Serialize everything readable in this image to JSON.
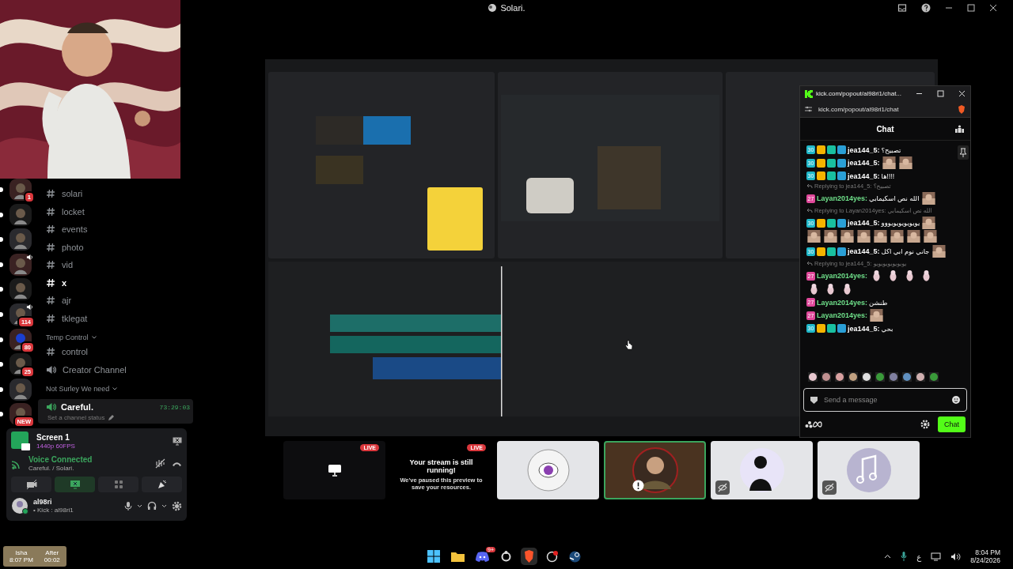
{
  "window": {
    "title": "Solari."
  },
  "webcam": {
    "kind": "picture"
  },
  "servers": [
    {
      "unread": true,
      "badge": "1"
    },
    {
      "unread": true
    },
    {
      "unread": true
    },
    {
      "unread": true,
      "voice": true
    },
    {
      "unread": true
    },
    {
      "unread": true,
      "voice": true,
      "badge": "114"
    },
    {
      "unread": true,
      "badge": "80"
    },
    {
      "unread": true,
      "badge": "25"
    },
    {
      "unread": true
    },
    {
      "unread": true,
      "badge": "NEW"
    }
  ],
  "channels": [
    {
      "kind": "text",
      "name": "solari",
      "unread": false
    },
    {
      "kind": "text",
      "name": "locket",
      "unread": false
    },
    {
      "kind": "text",
      "name": "events",
      "unread": false
    },
    {
      "kind": "text",
      "name": "photo",
      "unread": false
    },
    {
      "kind": "text",
      "name": "vid",
      "unread": false
    },
    {
      "kind": "text",
      "name": "x",
      "unread": true
    },
    {
      "kind": "text",
      "name": "ajr",
      "unread": false
    },
    {
      "kind": "text",
      "name": "tklegat",
      "unread": false
    },
    {
      "kind": "category",
      "name": "Temp Control",
      "children": [
        {
          "kind": "text",
          "name": "control",
          "unread": false
        },
        {
          "kind": "voice",
          "name": "Creator Channel",
          "unread": false
        }
      ]
    },
    {
      "kind": "category",
      "name": "Not Surley We need",
      "children": [
        {
          "kind": "voice",
          "name": "Careful.",
          "unread": true,
          "active": true,
          "timer": "73:29:03",
          "status": "Set a channel status"
        }
      ]
    }
  ],
  "stream": {
    "title": "Screen 1",
    "quality": "1440p 60FPS"
  },
  "voice": {
    "status": "Voice Connected",
    "location": "Careful. / Solari."
  },
  "controls": [
    {
      "kind": "camera",
      "on": false
    },
    {
      "kind": "screen",
      "on": true
    },
    {
      "kind": "activity",
      "on": false
    },
    {
      "kind": "soundboard",
      "on": false
    }
  ],
  "user": {
    "name": "al98ri",
    "status": "• Kick : al98ri1"
  },
  "stream_view": {
    "kind": "picture"
  },
  "chat": {
    "tab_title": "kick.com/popout/al98ri1/chat...",
    "url": "kick.com/popout/al98ri1/chat",
    "heading": "Chat",
    "messages": [
      {
        "kind": "message",
        "user": "jea144_5:",
        "color": "#ffffff",
        "badges": [
          {
            "kind": "sub",
            "text": "30"
          },
          {
            "kind": "crown"
          },
          {
            "kind": "og"
          },
          {
            "kind": "mod"
          }
        ],
        "text": "تصبيح؟"
      },
      {
        "kind": "message",
        "user": "jea144_5:",
        "color": "#ffffff",
        "badges": [
          {
            "kind": "sub",
            "text": "30"
          },
          {
            "kind": "crown"
          },
          {
            "kind": "og"
          },
          {
            "kind": "mod"
          }
        ],
        "emotes": [
          {
            "kind": "picture"
          },
          {
            "kind": "picture"
          }
        ]
      },
      {
        "kind": "message",
        "user": "jea144_5:",
        "color": "#ffffff",
        "badges": [
          {
            "kind": "sub",
            "text": "30"
          },
          {
            "kind": "crown"
          },
          {
            "kind": "og"
          },
          {
            "kind": "mod"
          }
        ],
        "text": "!!!!ها"
      },
      {
        "kind": "reply",
        "text": "Replying to jea144_5: تصبيح؟"
      },
      {
        "kind": "message",
        "user": "Layan2014yes:",
        "color": "#6fe08a",
        "badges": [
          {
            "kind": "gift",
            "text": "27"
          }
        ],
        "text": "الله نص اسكيمابي",
        "emotes": [
          {
            "kind": "picture"
          }
        ]
      },
      {
        "kind": "reply",
        "text": "Replying to Layan2014yes: الله نص اسكيمابي"
      },
      {
        "kind": "message",
        "user": "jea144_5:",
        "color": "#ffffff",
        "badges": [
          {
            "kind": "sub",
            "text": "30"
          },
          {
            "kind": "crown"
          },
          {
            "kind": "og"
          },
          {
            "kind": "mod"
          }
        ],
        "text": "يويويويويويووو",
        "emotes": [
          {
            "kind": "picture"
          },
          {
            "kind": "picture"
          },
          {
            "kind": "picture"
          },
          {
            "kind": "picture"
          },
          {
            "kind": "picture"
          },
          {
            "kind": "picture"
          },
          {
            "kind": "picture"
          },
          {
            "kind": "picture"
          },
          {
            "kind": "picture"
          }
        ]
      },
      {
        "kind": "message",
        "user": "jea144_5:",
        "color": "#ffffff",
        "badges": [
          {
            "kind": "sub",
            "text": "30"
          },
          {
            "kind": "crown"
          },
          {
            "kind": "og"
          },
          {
            "kind": "mod"
          }
        ],
        "text": "جاني نوم ابي اكل",
        "emotes": [
          {
            "kind": "picture"
          }
        ]
      },
      {
        "kind": "reply",
        "text": "Replying to jea144_5: يويويويويويويو"
      },
      {
        "kind": "message",
        "user": "Layan2014yes:",
        "color": "#6fe08a",
        "badges": [
          {
            "kind": "gift",
            "text": "27"
          }
        ],
        "emotes": [
          {
            "kind": "figure"
          },
          {
            "kind": "figure"
          },
          {
            "kind": "figure"
          },
          {
            "kind": "figure"
          },
          {
            "kind": "figure"
          },
          {
            "kind": "figure"
          },
          {
            "kind": "figure"
          }
        ]
      },
      {
        "kind": "message",
        "user": "Layan2014yes:",
        "color": "#6fe08a",
        "badges": [
          {
            "kind": "gift",
            "text": "27"
          }
        ],
        "text": "طنشن"
      },
      {
        "kind": "message",
        "user": "Layan2014yes:",
        "color": "#6fe08a",
        "badges": [
          {
            "kind": "gift",
            "text": "27"
          }
        ],
        "emotes": [
          {
            "kind": "picture"
          }
        ]
      },
      {
        "kind": "message",
        "user": "jea144_5:",
        "color": "#ffffff",
        "badges": [
          {
            "kind": "sub",
            "text": "30"
          },
          {
            "kind": "crown"
          },
          {
            "kind": "og"
          },
          {
            "kind": "mod"
          }
        ],
        "text": "بحي"
      }
    ],
    "placeholder": "Send a message",
    "send": "Chat"
  },
  "tiles": [
    {
      "kind": "screen",
      "badge": "LIVE",
      "speaking": false
    },
    {
      "kind": "paused",
      "badge": "LIVE",
      "speaking": false,
      "title": "Your stream is still running!",
      "text": "We've paused this preview to save your resources."
    },
    {
      "kind": "avatar",
      "speaking": false,
      "muted": false
    },
    {
      "kind": "avatar",
      "speaking": true,
      "muted": false,
      "alert": true
    },
    {
      "kind": "avatar",
      "speaking": false,
      "muted": true
    },
    {
      "kind": "avatar",
      "speaking": false,
      "muted": true
    }
  ],
  "taskbar": {
    "prayer": [
      {
        "label": "Isha",
        "value": "8:07 PM"
      },
      {
        "label": "After",
        "value": "00:02"
      }
    ],
    "language": "ع",
    "time": "8:04 PM",
    "date": "8/24/2026",
    "discord_badge": "9+"
  }
}
